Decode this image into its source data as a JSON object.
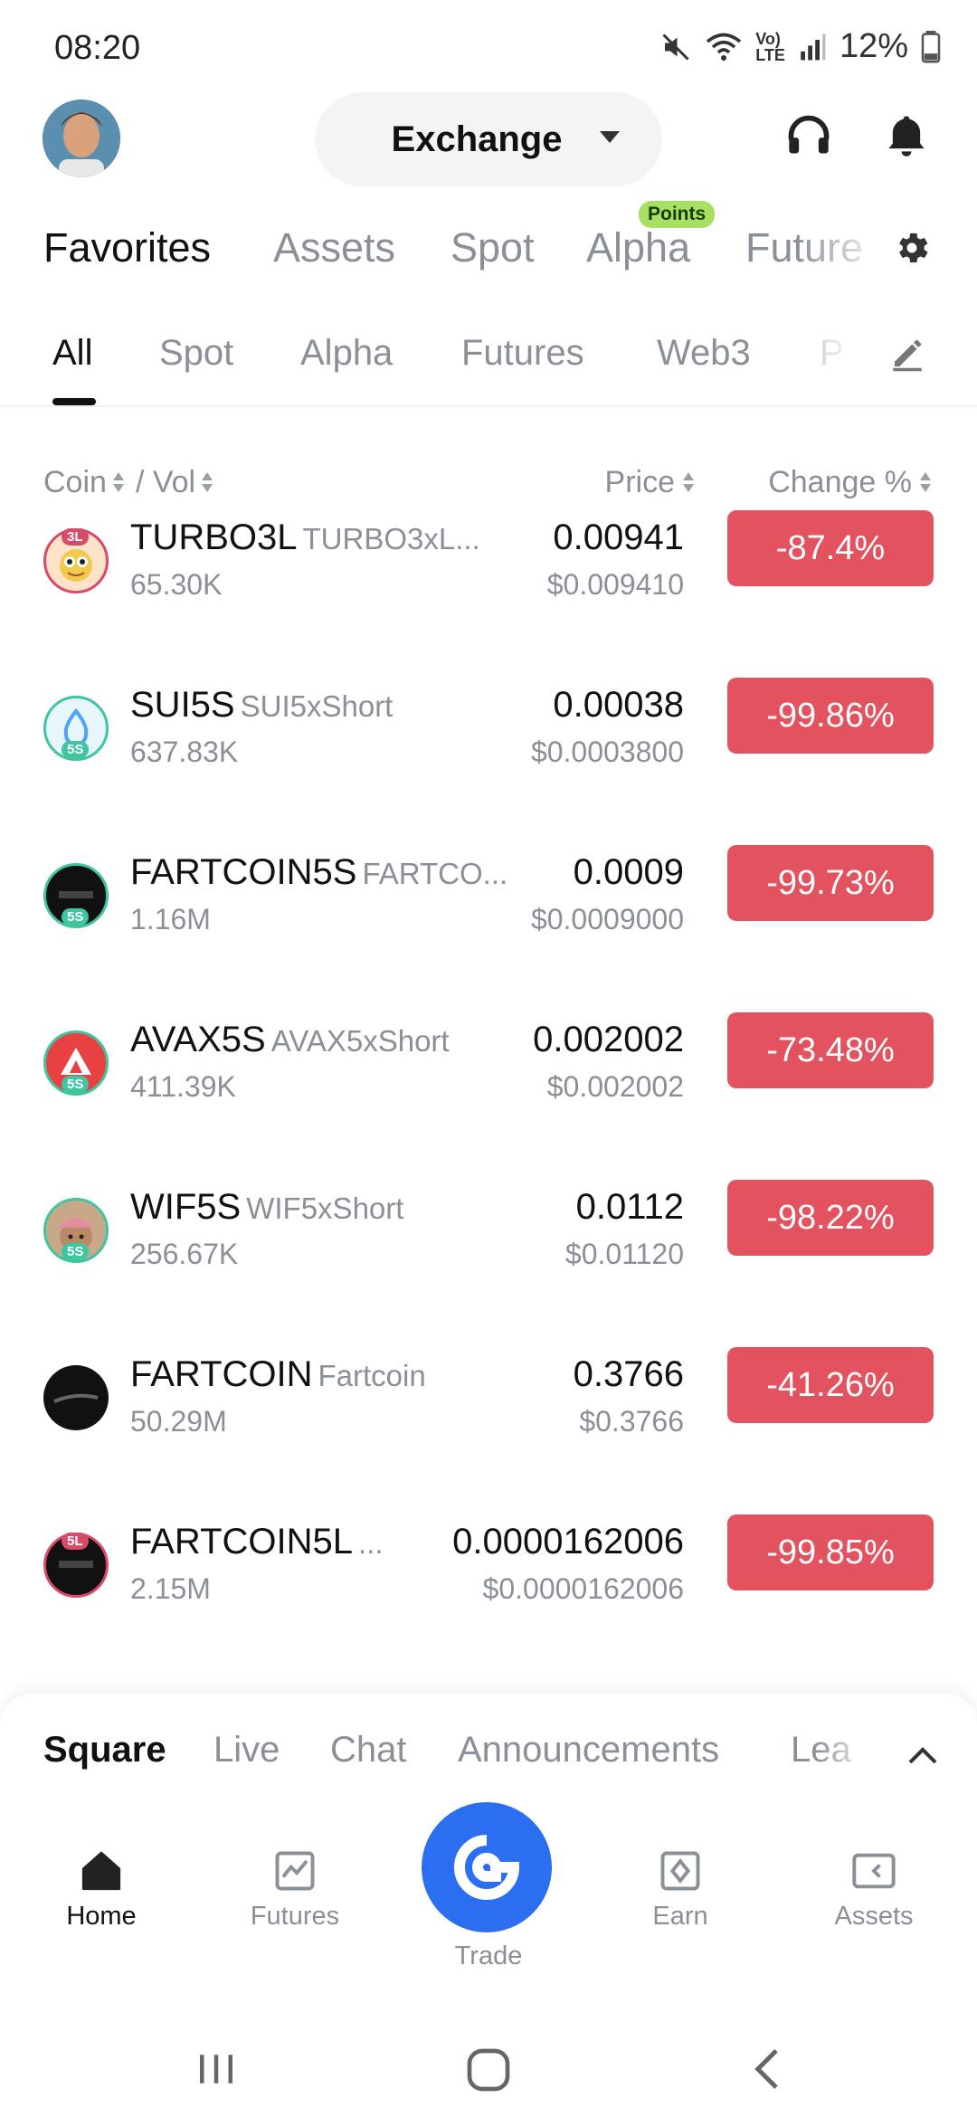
{
  "status": {
    "time": "08:20",
    "battery": "12%"
  },
  "header": {
    "exchange_label": "Exchange"
  },
  "top_tabs": [
    {
      "label": "Favorites"
    },
    {
      "label": "Assets"
    },
    {
      "label": "Spot"
    },
    {
      "label": "Alpha"
    },
    {
      "label": "Future"
    }
  ],
  "points_badge": "Points",
  "sub_tabs": [
    {
      "label": "All"
    },
    {
      "label": "Spot"
    },
    {
      "label": "Alpha"
    },
    {
      "label": "Futures"
    },
    {
      "label": "Web3"
    },
    {
      "label": "P"
    }
  ],
  "columns": {
    "coin": "Coin",
    "sep": "/ Vol",
    "price": "Price",
    "change": "Change %"
  },
  "rows": [
    {
      "symbol": "TURBO3L",
      "full": "TURBO3xL...",
      "vol": "65.30K",
      "price": "0.00941",
      "usd": "$0.009410",
      "change": "-87.4%",
      "badge": "3L"
    },
    {
      "symbol": "SUI5S",
      "full": "SUI5xShort",
      "vol": "637.83K",
      "price": "0.00038",
      "usd": "$0.0003800",
      "change": "-99.86%",
      "badge": "5S"
    },
    {
      "symbol": "FARTCOIN5S",
      "full": "FARTCO...",
      "vol": "1.16M",
      "price": "0.0009",
      "usd": "$0.0009000",
      "change": "-99.73%",
      "badge": "5S"
    },
    {
      "symbol": "AVAX5S",
      "full": "AVAX5xShort",
      "vol": "411.39K",
      "price": "0.002002",
      "usd": "$0.002002",
      "change": "-73.48%",
      "badge": "5S"
    },
    {
      "symbol": "WIF5S",
      "full": "WIF5xShort",
      "vol": "256.67K",
      "price": "0.0112",
      "usd": "$0.01120",
      "change": "-98.22%",
      "badge": "5S"
    },
    {
      "symbol": "FARTCOIN",
      "full": "Fartcoin",
      "vol": "50.29M",
      "price": "0.3766",
      "usd": "$0.3766",
      "change": "-41.26%",
      "badge": ""
    },
    {
      "symbol": "FARTCOIN5L",
      "full": "...",
      "vol": "2.15M",
      "price": "0.0000162006",
      "usd": "$0.0000162006",
      "change": "-99.85%",
      "badge": "5L"
    }
  ],
  "sheet_tabs": [
    {
      "label": "Square"
    },
    {
      "label": "Live"
    },
    {
      "label": "Chat"
    },
    {
      "label": "Announcements"
    },
    {
      "label": "Lea"
    }
  ],
  "nav": {
    "home": "Home",
    "futures": "Futures",
    "trade": "Trade",
    "earn": "Earn",
    "assets": "Assets"
  },
  "colors": {
    "negative": "#e2525f",
    "trade_blue": "#2b6ef0",
    "points_green": "#a8e063"
  }
}
